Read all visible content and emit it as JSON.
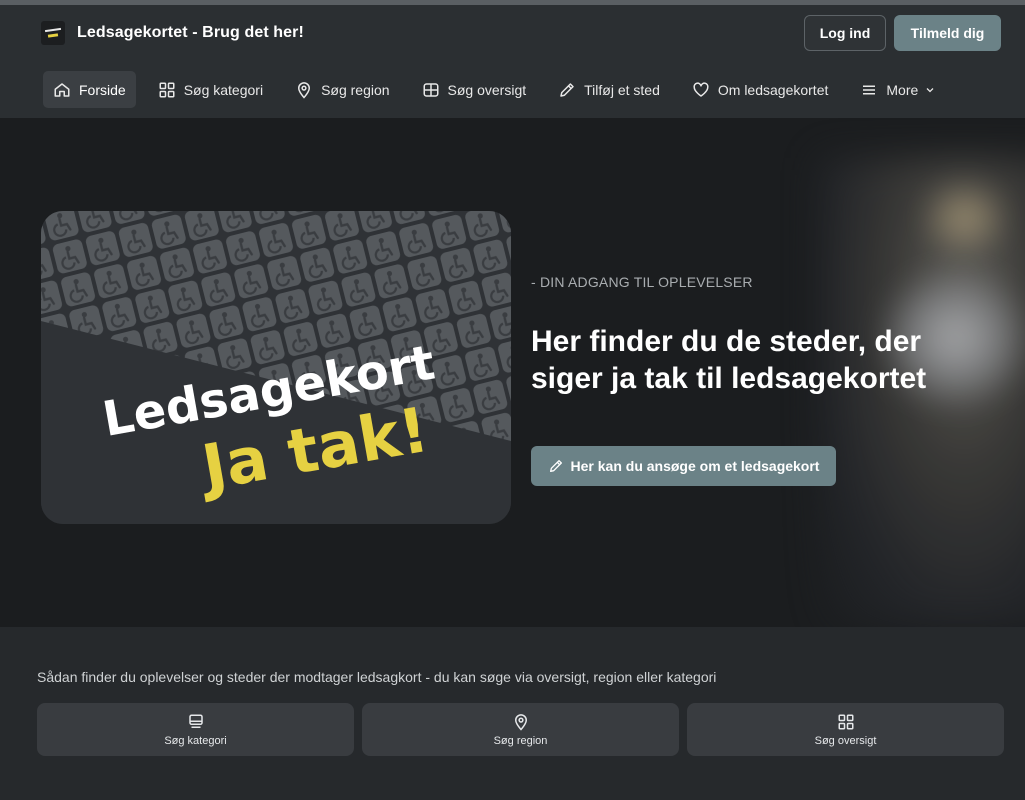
{
  "brand": {
    "title": "Ledsagekortet - Brug det her!",
    "logo_text": "Ledsagekort Ja tak"
  },
  "auth": {
    "login_label": "Log ind",
    "signup_label": "Tilmeld dig"
  },
  "nav": {
    "items": [
      {
        "label": "Forside",
        "icon": "home-icon",
        "active": true
      },
      {
        "label": "Søg kategori",
        "icon": "grid-icon",
        "active": false
      },
      {
        "label": "Søg region",
        "icon": "map-pin-icon",
        "active": false
      },
      {
        "label": "Søg oversigt",
        "icon": "layout-icon",
        "active": false
      },
      {
        "label": "Tilføj et sted",
        "icon": "pencil-icon",
        "active": false
      },
      {
        "label": "Om ledsagekortet",
        "icon": "heart-icon",
        "active": false
      },
      {
        "label": "More",
        "icon": "menu-icon",
        "active": false
      }
    ]
  },
  "hero": {
    "image_text_line1": "Ledsagekort",
    "image_text_line2": "Ja tak!",
    "eyebrow": "- DIN ADGANG TIL OPLEVELSER",
    "title": "Her finder du de steder, der siger ja tak til ledsagekortet",
    "cta_label": "Her kan du ansøge om et ledsagekort"
  },
  "lower": {
    "intro": "Sådan finder du oplevelser og steder der modtager ledsagkort - du kan søge via oversigt, region eller kategori",
    "cards": [
      {
        "label": "Søg kategori",
        "icon": "monitor-icon"
      },
      {
        "label": "Søg region",
        "icon": "map-pin-icon"
      },
      {
        "label": "Søg oversigt",
        "icon": "grid-icon"
      }
    ]
  },
  "colors": {
    "accent": "#6b8287",
    "header_bg": "#2b2f32",
    "hero_bg": "#1b1d1f",
    "logo_yellow": "#e6d142"
  }
}
